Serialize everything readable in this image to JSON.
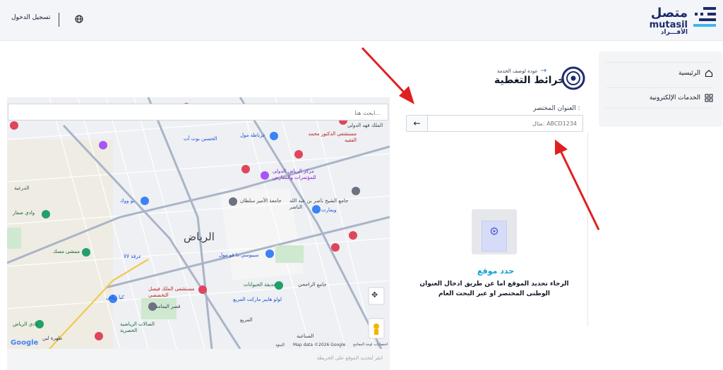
{
  "header": {
    "logo_ar": "متصل",
    "logo_en": "mutasil",
    "logo_sub": "الأفـــراد",
    "login": "تسجيل الدخول",
    "globe_icon": "globe-icon"
  },
  "sidebar": {
    "items": [
      {
        "label": "الرئيسية",
        "icon": "home-icon"
      },
      {
        "label": "الخدمات الإلكترونية",
        "icon": "grid-icon"
      }
    ]
  },
  "page": {
    "back": "عودة لوصف الخدمة",
    "title": "خرائط التغطية"
  },
  "short_address": {
    "label": "العنوان المختصر :",
    "placeholder": "مثال: ABCD1234",
    "submit_icon": "arrow-left-icon"
  },
  "location": {
    "title": "حدد موقع",
    "description": "الرجاء تحديد الموقع اما عن طريق ادخال العنوان الوطنى المختصر او عبر البحث العام"
  },
  "map": {
    "search_placeholder": "ابحث هنا...",
    "city": "الرياض",
    "footer_hint": "انقر لتحديد الموقع على الخريطة",
    "attribution": "Map data ©2026 Google",
    "terms": "البنود",
    "shortcuts": "اختصارات لوحة المفاتيح",
    "google": "Google",
    "labels": [
      "مستشفى الدكتور محمد الفقيه",
      "مركز الرياض الدولي للمؤتمرات والمعارض",
      "جامعة الأمير سلطان",
      "جامع الشيخ ناصر بن عبد الله الناصر",
      "ويمارت",
      "الحسبن بوت أت",
      "غرناطة مول",
      "الملك فهد الدولى",
      "بو ووك",
      "الدرعية",
      "وادي صفار",
      "ممشى مسك",
      "عرقة لالا",
      "سيبوسي دا فو مول",
      "حديقة الحيوانات",
      "لولو هايبر ماركت المربع",
      "مستشفى الملك فيصل التخصصي",
      "قصر اليمامة",
      "الصالات الرياضية الحصرية",
      "نادي الرياض",
      "طهرة لبن",
      "جامع الراجحي",
      "الصناعية",
      "المربع",
      "كيا رياض"
    ]
  },
  "colors": {
    "brand": "#1e2c6b",
    "accent": "#0f9ed5",
    "annotation": "#e02020"
  }
}
